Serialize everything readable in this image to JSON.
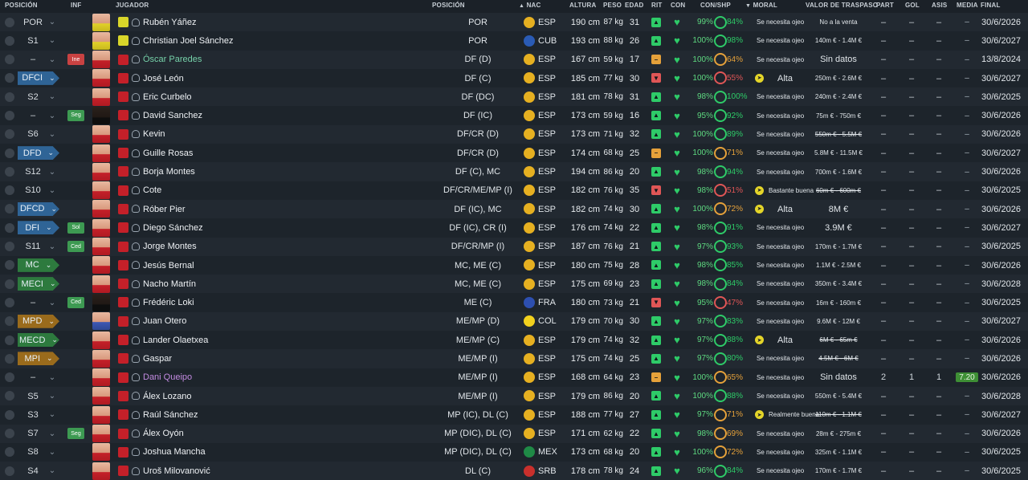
{
  "header": {
    "posicion": "POSICIÓN",
    "inf": "INF",
    "jugador": "JUGADOR",
    "posicion2": "POSICIÓN",
    "nac": "NAC",
    "altura": "ALTURA",
    "peso": "PESO",
    "edad": "EDAD",
    "rit": "RIT",
    "con": "CON",
    "conshp": "CON/SHP",
    "moral": "MORAL",
    "valor": "VALOR DE TRASPASO",
    "part": "PART",
    "gol": "GOL",
    "asis": "ASIS",
    "media": "MEDIA",
    "final": "FINAL"
  },
  "players": [
    {
      "slot": "POR",
      "slot_style": "plain",
      "inf": "",
      "inf_style": "",
      "name": "Rubén Yáñez",
      "name_style": "",
      "kit": "gk",
      "face": "gk",
      "pos": "POR",
      "flag": "esp",
      "nat": "ESP",
      "alt": "190 cm",
      "peso": "87 kg",
      "edad": "31",
      "rit": "up",
      "con": "99%",
      "shp": "84%",
      "moral_icon": "",
      "moral": "Se necesita ojeo",
      "moral_style": "",
      "val": "No a la venta",
      "val_style": "",
      "part": "–",
      "gol": "–",
      "asis": "–",
      "media": "–",
      "media_hl": false,
      "final": "30/6/2026"
    },
    {
      "slot": "S1",
      "slot_style": "plain",
      "inf": "",
      "inf_style": "",
      "name": "Christian Joel Sánchez",
      "name_style": "",
      "kit": "gk",
      "face": "gk",
      "pos": "POR",
      "flag": "cub",
      "nat": "CUB",
      "alt": "193 cm",
      "peso": "88 kg",
      "edad": "26",
      "rit": "up",
      "con": "100%",
      "shp": "98%",
      "moral_icon": "",
      "moral": "Se necesita ojeo",
      "moral_style": "",
      "val": "140m € - 1.4M €",
      "val_style": "",
      "part": "–",
      "gol": "–",
      "asis": "–",
      "media": "–",
      "media_hl": false,
      "final": "30/6/2027"
    },
    {
      "slot": "–",
      "slot_style": "plain",
      "inf": "Ine",
      "inf_style": "red",
      "name": "Óscar Paredes",
      "name_style": "teal",
      "kit": "",
      "face": "",
      "pos": "DF (D)",
      "flag": "esp",
      "nat": "ESP",
      "alt": "167 cm",
      "peso": "59 kg",
      "edad": "17",
      "rit": "mid",
      "con": "100%",
      "shp": "64%",
      "moral_icon": "",
      "moral": "Se necesita ojeo",
      "moral_style": "",
      "val": "Sin datos",
      "val_style": "big",
      "part": "–",
      "gol": "–",
      "asis": "–",
      "media": "–",
      "media_hl": false,
      "final": "13/8/2024"
    },
    {
      "slot": "DFCI",
      "slot_style": "blue",
      "inf": "",
      "inf_style": "",
      "name": "José León",
      "name_style": "",
      "kit": "",
      "face": "",
      "pos": "DF (C)",
      "flag": "esp",
      "nat": "ESP",
      "alt": "185 cm",
      "peso": "77 kg",
      "edad": "30",
      "rit": "down",
      "con": "100%",
      "shp": "55%",
      "moral_icon": "y",
      "moral": "Alta",
      "moral_style": "big",
      "val": "250m € - 2.6M €",
      "val_style": "",
      "part": "–",
      "gol": "–",
      "asis": "–",
      "media": "–",
      "media_hl": false,
      "final": "30/6/2027"
    },
    {
      "slot": "S2",
      "slot_style": "plain",
      "inf": "",
      "inf_style": "",
      "name": "Eric Curbelo",
      "name_style": "",
      "kit": "",
      "face": "",
      "pos": "DF (DC)",
      "flag": "esp",
      "nat": "ESP",
      "alt": "181 cm",
      "peso": "78 kg",
      "edad": "31",
      "rit": "up",
      "con": "98%",
      "shp": "100%",
      "moral_icon": "",
      "moral": "Se necesita ojeo",
      "moral_style": "",
      "val": "240m € - 2.4M €",
      "val_style": "",
      "part": "–",
      "gol": "–",
      "asis": "–",
      "media": "–",
      "media_hl": false,
      "final": "30/6/2025"
    },
    {
      "slot": "–",
      "slot_style": "plain",
      "inf": "Seg",
      "inf_style": "green",
      "name": "David Sanchez",
      "name_style": "",
      "kit": "",
      "face": "dark",
      "pos": "DF (IC)",
      "flag": "esp",
      "nat": "ESP",
      "alt": "173 cm",
      "peso": "59 kg",
      "edad": "16",
      "rit": "up",
      "con": "95%",
      "shp": "92%",
      "moral_icon": "",
      "moral": "Se necesita ojeo",
      "moral_style": "",
      "val": "75m € - 750m €",
      "val_style": "",
      "part": "–",
      "gol": "–",
      "asis": "–",
      "media": "–",
      "media_hl": false,
      "final": "30/6/2026"
    },
    {
      "slot": "S6",
      "slot_style": "plain",
      "inf": "",
      "inf_style": "",
      "name": "Kevin",
      "name_style": "",
      "kit": "",
      "face": "",
      "pos": "DF/CR (D)",
      "flag": "esp",
      "nat": "ESP",
      "alt": "173 cm",
      "peso": "71 kg",
      "edad": "32",
      "rit": "up",
      "con": "100%",
      "shp": "89%",
      "moral_icon": "",
      "moral": "Se necesita ojeo",
      "moral_style": "",
      "val": "550m € - 5.5M €",
      "val_style": "strike",
      "part": "–",
      "gol": "–",
      "asis": "–",
      "media": "–",
      "media_hl": false,
      "final": "30/6/2026"
    },
    {
      "slot": "DFD",
      "slot_style": "blue",
      "inf": "",
      "inf_style": "",
      "name": "Guille Rosas",
      "name_style": "",
      "kit": "",
      "face": "",
      "pos": "DF/CR (D)",
      "flag": "esp",
      "nat": "ESP",
      "alt": "174 cm",
      "peso": "68 kg",
      "edad": "25",
      "rit": "mid",
      "con": "100%",
      "shp": "71%",
      "moral_icon": "",
      "moral": "Se necesita ojeo",
      "moral_style": "",
      "val": "5.8M € - 11.5M €",
      "val_style": "",
      "part": "–",
      "gol": "–",
      "asis": "–",
      "media": "–",
      "media_hl": false,
      "final": "30/6/2027"
    },
    {
      "slot": "S12",
      "slot_style": "plain",
      "inf": "",
      "inf_style": "",
      "name": "Borja Montes",
      "name_style": "",
      "kit": "",
      "face": "",
      "pos": "DF (C), MC",
      "flag": "esp",
      "nat": "ESP",
      "alt": "194 cm",
      "peso": "86 kg",
      "edad": "20",
      "rit": "up",
      "con": "98%",
      "shp": "94%",
      "moral_icon": "",
      "moral": "Se necesita ojeo",
      "moral_style": "",
      "val": "700m € - 1.6M €",
      "val_style": "",
      "part": "–",
      "gol": "–",
      "asis": "–",
      "media": "–",
      "media_hl": false,
      "final": "30/6/2026"
    },
    {
      "slot": "S10",
      "slot_style": "plain",
      "inf": "",
      "inf_style": "",
      "name": "Cote",
      "name_style": "",
      "kit": "",
      "face": "",
      "pos": "DF/CR/ME/MP (I)",
      "flag": "esp",
      "nat": "ESP",
      "alt": "182 cm",
      "peso": "76 kg",
      "edad": "35",
      "rit": "down",
      "con": "98%",
      "shp": "51%",
      "moral_icon": "y",
      "moral": "Bastante buena",
      "moral_style": "mid",
      "val": "60m € - 600m €",
      "val_style": "strike",
      "part": "–",
      "gol": "–",
      "asis": "–",
      "media": "–",
      "media_hl": false,
      "final": "30/6/2025"
    },
    {
      "slot": "DFCD",
      "slot_style": "blue",
      "inf": "",
      "inf_style": "",
      "name": "Róber Pier",
      "name_style": "",
      "kit": "",
      "face": "",
      "pos": "DF (IC), MC",
      "flag": "esp",
      "nat": "ESP",
      "alt": "182 cm",
      "peso": "74 kg",
      "edad": "30",
      "rit": "up",
      "con": "100%",
      "shp": "72%",
      "moral_icon": "y",
      "moral": "Alta",
      "moral_style": "big",
      "val": "8M €",
      "val_style": "big",
      "part": "–",
      "gol": "–",
      "asis": "–",
      "media": "–",
      "media_hl": false,
      "final": "30/6/2026"
    },
    {
      "slot": "DFI",
      "slot_style": "blue",
      "inf": "Sol",
      "inf_style": "green",
      "name": "Diego Sánchez",
      "name_style": "",
      "kit": "",
      "face": "",
      "pos": "DF (IC), CR (I)",
      "flag": "esp",
      "nat": "ESP",
      "alt": "176 cm",
      "peso": "74 kg",
      "edad": "22",
      "rit": "up",
      "con": "98%",
      "shp": "91%",
      "moral_icon": "",
      "moral": "Se necesita ojeo",
      "moral_style": "",
      "val": "3.9M €",
      "val_style": "big",
      "part": "–",
      "gol": "–",
      "asis": "–",
      "media": "–",
      "media_hl": false,
      "final": "30/6/2027"
    },
    {
      "slot": "S11",
      "slot_style": "plain",
      "inf": "Ced",
      "inf_style": "green",
      "name": "Jorge Montes",
      "name_style": "",
      "kit": "",
      "face": "",
      "pos": "DF/CR/MP (I)",
      "flag": "esp",
      "nat": "ESP",
      "alt": "187 cm",
      "peso": "76 kg",
      "edad": "21",
      "rit": "up",
      "con": "97%",
      "shp": "93%",
      "moral_icon": "",
      "moral": "Se necesita ojeo",
      "moral_style": "",
      "val": "170m € - 1.7M €",
      "val_style": "",
      "part": "–",
      "gol": "–",
      "asis": "–",
      "media": "–",
      "media_hl": false,
      "final": "30/6/2025"
    },
    {
      "slot": "MC",
      "slot_style": "green",
      "inf": "",
      "inf_style": "",
      "name": "Jesús Bernal",
      "name_style": "",
      "kit": "",
      "face": "",
      "pos": "MC, ME (C)",
      "flag": "esp",
      "nat": "ESP",
      "alt": "180 cm",
      "peso": "75 kg",
      "edad": "28",
      "rit": "up",
      "con": "98%",
      "shp": "85%",
      "moral_icon": "",
      "moral": "Se necesita ojeo",
      "moral_style": "",
      "val": "1.1M € - 2.5M €",
      "val_style": "",
      "part": "–",
      "gol": "–",
      "asis": "–",
      "media": "–",
      "media_hl": false,
      "final": "30/6/2026"
    },
    {
      "slot": "MECI",
      "slot_style": "green",
      "inf": "",
      "inf_style": "",
      "name": "Nacho Martín",
      "name_style": "",
      "kit": "",
      "face": "",
      "pos": "MC, ME (C)",
      "flag": "esp",
      "nat": "ESP",
      "alt": "175 cm",
      "peso": "69 kg",
      "edad": "23",
      "rit": "up",
      "con": "98%",
      "shp": "84%",
      "moral_icon": "",
      "moral": "Se necesita ojeo",
      "moral_style": "",
      "val": "350m € - 3.4M €",
      "val_style": "",
      "part": "–",
      "gol": "–",
      "asis": "–",
      "media": "–",
      "media_hl": false,
      "final": "30/6/2028"
    },
    {
      "slot": "–",
      "slot_style": "plain",
      "inf": "Ced",
      "inf_style": "green",
      "name": "Frédéric Loki",
      "name_style": "",
      "kit": "",
      "face": "dark",
      "pos": "ME (C)",
      "flag": "fra",
      "nat": "FRA",
      "alt": "180 cm",
      "peso": "73 kg",
      "edad": "21",
      "rit": "down",
      "con": "95%",
      "shp": "47%",
      "moral_icon": "",
      "moral": "Se necesita ojeo",
      "moral_style": "",
      "val": "16m € - 160m €",
      "val_style": "",
      "part": "–",
      "gol": "–",
      "asis": "–",
      "media": "–",
      "media_hl": false,
      "final": "30/6/2025"
    },
    {
      "slot": "MPD",
      "slot_style": "gold",
      "inf": "",
      "inf_style": "",
      "name": "Juan Otero",
      "name_style": "",
      "kit": "",
      "face": "blue",
      "pos": "ME/MP (D)",
      "flag": "col",
      "nat": "COL",
      "alt": "179 cm",
      "peso": "70 kg",
      "edad": "30",
      "rit": "up",
      "con": "97%",
      "shp": "83%",
      "moral_icon": "",
      "moral": "Se necesita ojeo",
      "moral_style": "",
      "val": "9.6M € - 12M €",
      "val_style": "",
      "part": "–",
      "gol": "–",
      "asis": "–",
      "media": "–",
      "media_hl": false,
      "final": "30/6/2027"
    },
    {
      "slot": "MECD",
      "slot_style": "green",
      "inf": "",
      "inf_style": "",
      "name": "Lander Olaetxea",
      "name_style": "",
      "kit": "",
      "face": "",
      "pos": "ME/MP (C)",
      "flag": "esp",
      "nat": "ESP",
      "alt": "179 cm",
      "peso": "74 kg",
      "edad": "32",
      "rit": "up",
      "con": "97%",
      "shp": "88%",
      "moral_icon": "y",
      "moral": "Alta",
      "moral_style": "big",
      "val": "6M € - 65m €",
      "val_style": "strike",
      "part": "–",
      "gol": "–",
      "asis": "–",
      "media": "–",
      "media_hl": false,
      "final": "30/6/2026"
    },
    {
      "slot": "MPI",
      "slot_style": "gold",
      "inf": "",
      "inf_style": "",
      "name": "Gaspar",
      "name_style": "",
      "kit": "",
      "face": "",
      "pos": "ME/MP (I)",
      "flag": "esp",
      "nat": "ESP",
      "alt": "175 cm",
      "peso": "74 kg",
      "edad": "25",
      "rit": "up",
      "con": "97%",
      "shp": "80%",
      "moral_icon": "",
      "moral": "Se necesita ojeo",
      "moral_style": "",
      "val": "4.5M € - 6M €",
      "val_style": "strike",
      "part": "–",
      "gol": "–",
      "asis": "–",
      "media": "–",
      "media_hl": false,
      "final": "30/6/2026"
    },
    {
      "slot": "–",
      "slot_style": "plain",
      "inf": "",
      "inf_style": "",
      "name": "Dani Queipo",
      "name_style": "purple",
      "kit": "",
      "face": "",
      "pos": "ME/MP (I)",
      "flag": "esp",
      "nat": "ESP",
      "alt": "168 cm",
      "peso": "64 kg",
      "edad": "23",
      "rit": "mid",
      "con": "100%",
      "shp": "65%",
      "moral_icon": "",
      "moral": "Se necesita ojeo",
      "moral_style": "",
      "val": "Sin datos",
      "val_style": "big",
      "part": "2",
      "gol": "1",
      "asis": "1",
      "media": "7.20",
      "media_hl": true,
      "final": "30/6/2026"
    },
    {
      "slot": "S5",
      "slot_style": "plain",
      "inf": "",
      "inf_style": "",
      "name": "Álex Lozano",
      "name_style": "",
      "kit": "",
      "face": "",
      "pos": "ME/MP (I)",
      "flag": "esp",
      "nat": "ESP",
      "alt": "179 cm",
      "peso": "86 kg",
      "edad": "20",
      "rit": "up",
      "con": "100%",
      "shp": "88%",
      "moral_icon": "",
      "moral": "Se necesita ojeo",
      "moral_style": "",
      "val": "550m € - 5.4M €",
      "val_style": "",
      "part": "–",
      "gol": "–",
      "asis": "–",
      "media": "–",
      "media_hl": false,
      "final": "30/6/2028"
    },
    {
      "slot": "S3",
      "slot_style": "plain",
      "inf": "",
      "inf_style": "",
      "name": "Raúl Sánchez",
      "name_style": "",
      "kit": "",
      "face": "",
      "pos": "MP (IC), DL (C)",
      "flag": "esp",
      "nat": "ESP",
      "alt": "188 cm",
      "peso": "77 kg",
      "edad": "27",
      "rit": "up",
      "con": "97%",
      "shp": "71%",
      "moral_icon": "y",
      "moral": "Realmente buena",
      "moral_style": "mid",
      "val": "110m € - 1.1M €",
      "val_style": "strike",
      "part": "–",
      "gol": "–",
      "asis": "–",
      "media": "–",
      "media_hl": false,
      "final": "30/6/2027"
    },
    {
      "slot": "S7",
      "slot_style": "plain",
      "inf": "Seg",
      "inf_style": "green",
      "name": "Álex Oyón",
      "name_style": "",
      "kit": "",
      "face": "",
      "pos": "MP (DIC), DL (C)",
      "flag": "esp",
      "nat": "ESP",
      "alt": "171 cm",
      "peso": "62 kg",
      "edad": "22",
      "rit": "up",
      "con": "98%",
      "shp": "69%",
      "moral_icon": "",
      "moral": "Se necesita ojeo",
      "moral_style": "",
      "val": "28m € - 275m €",
      "val_style": "",
      "part": "–",
      "gol": "–",
      "asis": "–",
      "media": "–",
      "media_hl": false,
      "final": "30/6/2026"
    },
    {
      "slot": "S8",
      "slot_style": "plain",
      "inf": "",
      "inf_style": "",
      "name": "Joshua Mancha",
      "name_style": "",
      "kit": "",
      "face": "",
      "pos": "MP (DIC), DL (C)",
      "flag": "mex",
      "nat": "MEX",
      "alt": "173 cm",
      "peso": "68 kg",
      "edad": "20",
      "rit": "up",
      "con": "100%",
      "shp": "72%",
      "moral_icon": "",
      "moral": "Se necesita ojeo",
      "moral_style": "",
      "val": "325m € - 1.1M €",
      "val_style": "",
      "part": "–",
      "gol": "–",
      "asis": "–",
      "media": "–",
      "media_hl": false,
      "final": "30/6/2025"
    },
    {
      "slot": "S4",
      "slot_style": "plain",
      "inf": "",
      "inf_style": "",
      "name": "Uroš Milovanović",
      "name_style": "",
      "kit": "",
      "face": "",
      "pos": "DL (C)",
      "flag": "srb",
      "nat": "SRB",
      "alt": "178 cm",
      "peso": "78 kg",
      "edad": "24",
      "rit": "up",
      "con": "96%",
      "shp": "84%",
      "moral_icon": "",
      "moral": "Se necesita ojeo",
      "moral_style": "",
      "val": "170m € - 1.7M €",
      "val_style": "",
      "part": "–",
      "gol": "–",
      "asis": "–",
      "media": "–",
      "media_hl": false,
      "final": "30/6/2025"
    }
  ],
  "colors": {
    "rit_up": "#2ecb68",
    "rit_mid": "#e5a13a",
    "rit_down": "#e05656",
    "flag_esp": "#e6b021",
    "flag_cub": "#2a5bb5",
    "flag_fra": "#2d4fb0",
    "flag_col": "#f2d11e",
    "flag_mex": "#1f8a46",
    "flag_srb": "#c9302c"
  }
}
